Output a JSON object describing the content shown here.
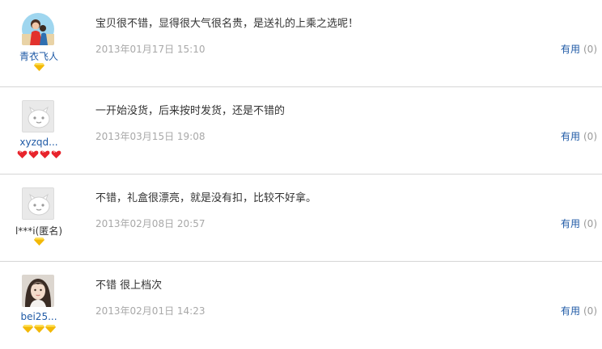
{
  "reviews": [
    {
      "username": "青衣飞人",
      "avatar": "photo-avatar",
      "badge_type": "yellow-diamond",
      "badge_count": 1,
      "content": "宝贝很不错，显得很大气很名贵，是送礼的上乘之选呢！",
      "date": "2013年01月17日 15:10",
      "useful_label": "有用",
      "useful_count": "(0)"
    },
    {
      "username": "xyzqd...",
      "avatar": "default-avatar",
      "badge_type": "red-heart",
      "badge_count": 4,
      "content": "一开始没货，后来按时发货，还是不错的",
      "date": "2013年03月15日 19:08",
      "useful_label": "有用",
      "useful_count": "(0)"
    },
    {
      "username": "l***i(匿名)",
      "avatar": "default-avatar",
      "badge_type": "yellow-diamond",
      "badge_count": 1,
      "content": "不错，礼盒很漂亮，就是没有扣，比较不好拿。",
      "date": "2013年02月08日 20:57",
      "useful_label": "有用",
      "useful_count": "(0)"
    },
    {
      "username": "bei25...",
      "avatar": "photo-avatar",
      "badge_type": "yellow-diamond",
      "badge_count": 3,
      "content": "不错 很上档次",
      "date": "2013年02月01日 14:23",
      "useful_label": "有用",
      "useful_count": "(0)"
    }
  ],
  "colors": {
    "link": "#1f5aa6",
    "date": "#a8a8a8",
    "text": "#333333",
    "divider": "#d6d6d6",
    "diamond": "#f2b807",
    "heart": "#e8242c"
  }
}
